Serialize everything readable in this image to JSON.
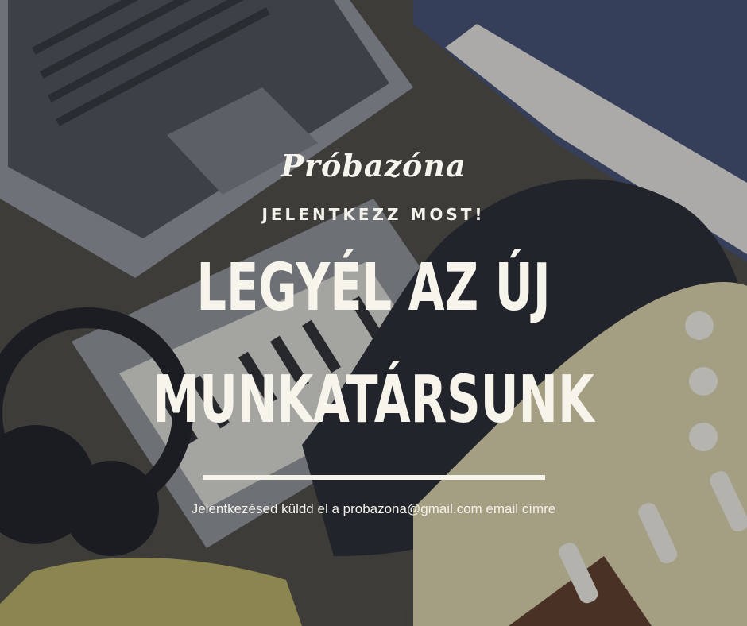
{
  "brand": {
    "logo_text": "Próbazóna"
  },
  "poster": {
    "kicker": "JELENTKEZZ MOST!",
    "headline_line1": "LEGYÉL AZ ÚJ",
    "headline_line2": "MUNKATÁRSUNK",
    "info": "Jelentkezésed küldd el a probazona@gmail.com email címre"
  },
  "colors": {
    "text": "#f7f4ec",
    "overlay": "#1e2228"
  }
}
